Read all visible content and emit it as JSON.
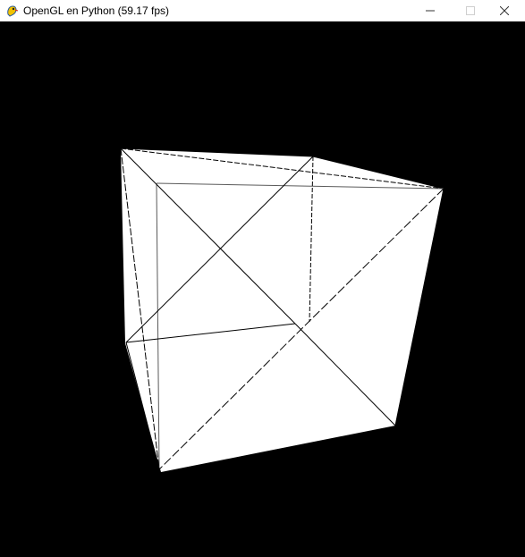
{
  "window": {
    "title": "OpenGL en Python (59.17 fps)",
    "icons": {
      "app": "pygame-snake-icon",
      "minimize": "minimize-icon",
      "maximize": "maximize-icon",
      "close": "close-icon"
    }
  },
  "scene": {
    "background_color": "#000000",
    "face_color": "#ffffff",
    "edge_color": "#000000",
    "object": "cube"
  }
}
